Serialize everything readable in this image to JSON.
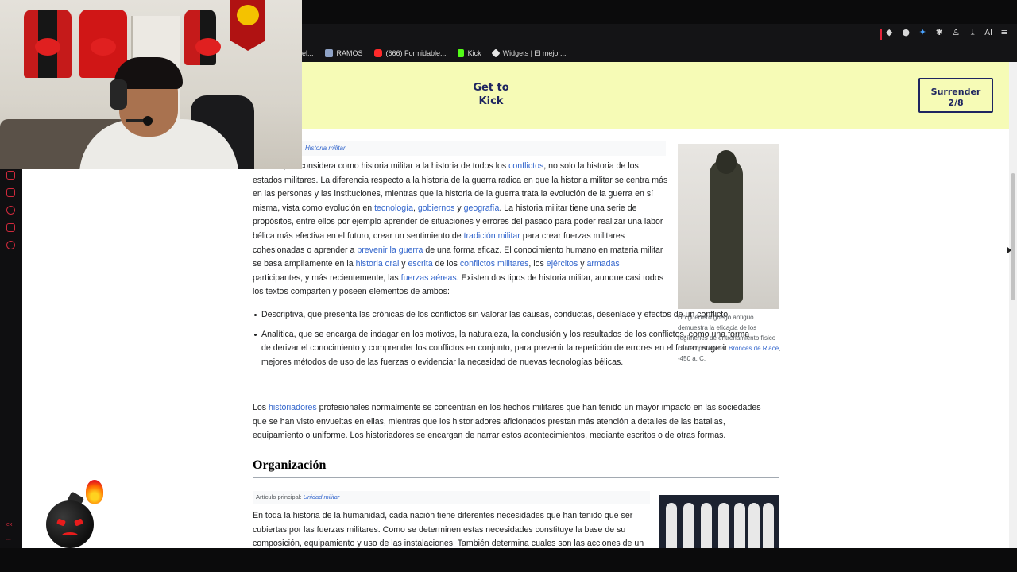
{
  "bookmarks": [
    {
      "label": "el...",
      "icon": "folder-icon"
    },
    {
      "label": "RAMOS",
      "icon": "page-icon"
    },
    {
      "label": "(666) Formidable...",
      "icon": "youtube-icon"
    },
    {
      "label": "Kick",
      "icon": "kick-icon"
    },
    {
      "label": "Widgets | El mejor...",
      "icon": "widgets-icon"
    }
  ],
  "toolbar": {
    "ai_label": "AI"
  },
  "promo": {
    "line1": "Get to",
    "line2": "Kick",
    "surrender_line1": "Surrender",
    "surrender_line2": "2/8"
  },
  "left_strip": {
    "bottom_label_1": "ex",
    "bottom_label_2": "..."
  },
  "article": {
    "hatnote_link": "Historia militar",
    "p1": [
      {
        "t": "Además, se considera como historia militar a la historia de todos los "
      },
      {
        "t": "conflictos",
        "link": true
      },
      {
        "t": ", no solo la historia de los estados militares. La diferencia respecto a la historia de la guerra radica en que la historia militar se centra más en las personas y las instituciones, mientras que la historia de la guerra trata la evolución de la guerra en sí misma, vista como evolución en "
      },
      {
        "t": "tecnología",
        "link": true
      },
      {
        "t": ", "
      },
      {
        "t": "gobiernos",
        "link": true
      },
      {
        "t": " y "
      },
      {
        "t": "geografía",
        "link": true
      },
      {
        "t": ". La historia militar tiene una serie de propósitos, entre ellos por ejemplo aprender de situaciones y errores del pasado para poder realizar una labor bélica más efectiva en el futuro, crear un sentimiento de "
      },
      {
        "t": "tradición militar",
        "link": true
      },
      {
        "t": " para crear fuerzas militares cohesionadas o aprender a "
      },
      {
        "t": "prevenir la guerra",
        "link": true
      },
      {
        "t": " de una forma eficaz. El conocimiento humano en materia militar se basa ampliamente en la "
      },
      {
        "t": "historia oral",
        "link": true
      },
      {
        "t": " y "
      },
      {
        "t": "escrita",
        "link": true
      },
      {
        "t": " de los "
      },
      {
        "t": "conflictos militares",
        "link": true
      },
      {
        "t": ", los "
      },
      {
        "t": "ejércitos",
        "link": true
      },
      {
        "t": " y "
      },
      {
        "t": "armadas",
        "link": true
      },
      {
        "t": " participantes, y más recientemente, las "
      },
      {
        "t": "fuerzas aéreas",
        "link": true
      },
      {
        "t": ". Existen dos tipos de historia militar, aunque casi todos los textos comparten y poseen elementos de ambos:"
      }
    ],
    "bullets": [
      "Descriptiva, que presenta las crónicas de los conflictos sin valorar las causas, conductas, desenlace y efectos de un conflicto.",
      "Analítica, que se encarga de indagar en los motivos, la naturaleza, la conclusión y los resultados de los conflictos, como una forma de derivar el conocimiento y comprender los conflictos en conjunto, para prevenir la repetición de errores en el futuro, sugerir mejores métodos de uso de las fuerzas o evidenciar la necesidad de nuevas tecnologías bélicas."
    ],
    "p2": [
      {
        "t": "Los "
      },
      {
        "t": "historiadores",
        "link": true
      },
      {
        "t": " profesionales normalmente se concentran en los hechos militares que han tenido un mayor impacto en las sociedades que se han visto envueltas en ellas, mientras que los historiadores aficionados prestan más atención a detalles de las batallas, equipamiento o uniforme. Los historiadores se encargan de narrar estos acontecimientos, mediante escritos o de otras formas."
      }
    ],
    "h2": "Organización",
    "hatnote2_prefix": "Artículo principal: ",
    "hatnote2_link": "Unidad militar",
    "p3": "En toda la historia de la humanidad, cada nación tiene diferentes necesidades que han tenido que ser cubiertas por las fuerzas militares. Como se determinen estas necesidades constituye la base de su composición, equipamiento y uso de las instalaciones. También determina cuales son las acciones de un",
    "caption1_text": "Un guerrero griego antiguo demuestra la eficacia de los regímenes de entrenamiento físico contemporáneos. ",
    "caption1_link": "Bronces de Riace",
    "caption1_tail": ", -450 a. C."
  },
  "colors": {
    "promo_bg": "#f6fbb6",
    "promo_text": "#1e2560",
    "link": "#3366cc",
    "accent_red": "#e0243a"
  }
}
